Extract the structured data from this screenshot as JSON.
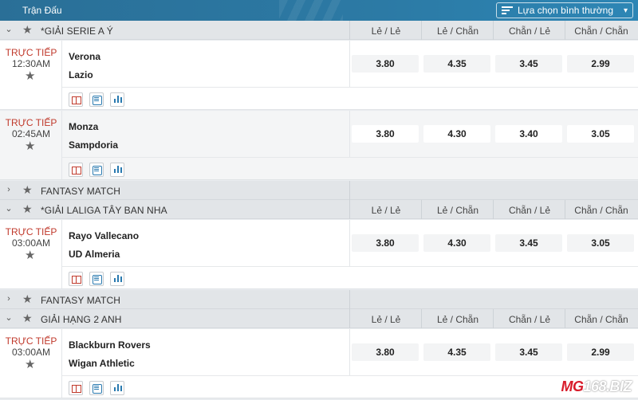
{
  "header": {
    "title": "Trận Đấu",
    "sort_label": "Lựa chọn bình thường"
  },
  "columns": [
    "Lẻ / Lẻ",
    "Lẻ / Chẵn",
    "Chẵn / Lẻ",
    "Chẵn / Chẵn"
  ],
  "leagues": [
    {
      "name": "*GIẢI SERIE A Ý",
      "matches": [
        {
          "status": "TRỰC TIẾP",
          "time": "12:30AM",
          "home": "Verona",
          "away": "Lazio",
          "odds": [
            "3.80",
            "4.35",
            "3.45",
            "2.99"
          ]
        },
        {
          "status": "TRỰC TIẾP",
          "time": "02:45AM",
          "home": "Monza",
          "away": "Sampdoria",
          "odds": [
            "3.80",
            "4.30",
            "3.40",
            "3.05"
          ]
        }
      ]
    },
    {
      "name": "FANTASY MATCH",
      "collapsed": true
    },
    {
      "name": "*GIẢI LALIGA TÂY BAN NHA",
      "matches": [
        {
          "status": "TRỰC TIẾP",
          "time": "03:00AM",
          "home": "Rayo Vallecano",
          "away": "UD Almeria",
          "odds": [
            "3.80",
            "4.30",
            "3.45",
            "3.05"
          ]
        }
      ]
    },
    {
      "name": "FANTASY MATCH",
      "collapsed": true
    },
    {
      "name": "GIẢI HẠNG 2 ANH",
      "matches": [
        {
          "status": "TRỰC TIẾP",
          "time": "03:00AM",
          "home": "Blackburn Rovers",
          "away": "Wigan Athletic",
          "odds": [
            "3.80",
            "4.35",
            "3.45",
            "2.99"
          ]
        }
      ]
    }
  ],
  "logo": {
    "part1": "MG",
    "part2": "168.BIZ"
  },
  "colors": {
    "accent": "#2c7aa5",
    "live": "#c0392b",
    "logo_red": "#d81b2a"
  }
}
